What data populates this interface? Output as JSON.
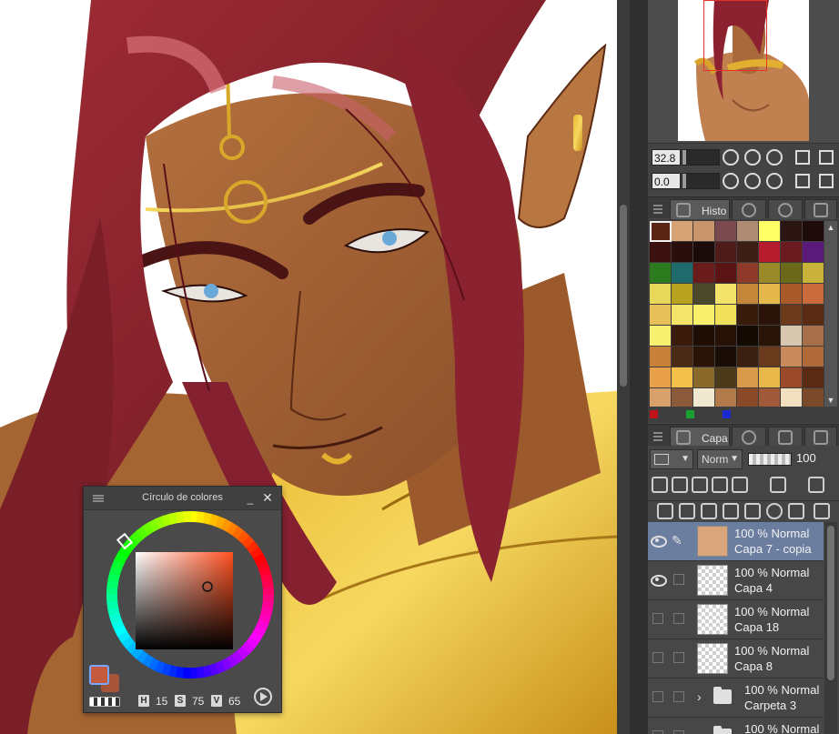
{
  "color_wheel": {
    "title": "Círculo de colores",
    "hsv": {
      "h_label": "H",
      "h_value": "15",
      "s_label": "S",
      "s_value": "75",
      "v_label": "V",
      "v_value": "65"
    }
  },
  "navigator": {
    "zoom": "32.8",
    "rotation": "0.0"
  },
  "palette_panel": {
    "tab_label": "Histo"
  },
  "palette": {
    "colors": [
      "#5a2616",
      "#d8a277",
      "#c9956d",
      "#7a4a50",
      "#b08b73",
      "#ffff66",
      "#2a1513",
      "#1e0c0a",
      "#3b1010",
      "#2a0e0b",
      "#1a0a08",
      "#4f1a1a",
      "#3d1e14",
      "#b71c2e",
      "#6b1a1f",
      "#5a1a7a",
      "#2e7a1f",
      "#1f6a6a",
      "#6a1c1c",
      "#5a1414",
      "#8e3a2a",
      "#9a8a2a",
      "#6a6a1a",
      "#c9b23a",
      "#e8d85a",
      "#b8a21e",
      "#4a4a2a",
      "#f4e36a",
      "#c4873a",
      "#e4b84a",
      "#a85a2a",
      "#c86a3a",
      "#e8c05a",
      "#f4e56a",
      "#f8f06a",
      "#f0e05a",
      "#3a1c0c",
      "#2a140a",
      "#6a3a1a",
      "#5a2a12",
      "#f8f070",
      "#3a1a0a",
      "#1e0e06",
      "#281208",
      "#140a04",
      "#2a1408",
      "#d8c8b0",
      "#a8704a",
      "#c8803a",
      "#4a2a14",
      "#2a1408",
      "#1a0c06",
      "#3a2010",
      "#6a3a1c",
      "#c88a5a",
      "#b06a3a",
      "#e8a04a",
      "#f4c04a",
      "#8a6a2a",
      "#4a3a1a",
      "#d89a4a",
      "#e8b84a",
      "#9a4a2a",
      "#5a2a14",
      "#d8a06a",
      "#8a5a3a",
      "#f0e8d0",
      "#b07a4a",
      "#8a4a2a",
      "#a05a3a",
      "#f0e0c0",
      "#7a4a2a"
    ],
    "footer_colors": [
      "#c0141a",
      "#18a030",
      "#1a2ad0"
    ]
  },
  "layers_panel": {
    "tab_label": "Capa",
    "blend_mode": "Norm",
    "opacity": "100",
    "layers": [
      {
        "mode": "100 % Normal",
        "name": "Capa 7 - copia",
        "selected": true,
        "visible": true,
        "type": "layer",
        "thumb": "art"
      },
      {
        "mode": "100 % Normal",
        "name": "Capa 4",
        "selected": false,
        "visible": true,
        "type": "layer",
        "thumb": "empty"
      },
      {
        "mode": "100 % Normal",
        "name": "Capa 18",
        "selected": false,
        "visible": false,
        "type": "layer",
        "thumb": "empty"
      },
      {
        "mode": "100 % Normal",
        "name": "Capa 8",
        "selected": false,
        "visible": false,
        "type": "layer",
        "thumb": "empty"
      },
      {
        "mode": "100 % Normal",
        "name": "Carpeta 3",
        "selected": false,
        "visible": false,
        "type": "folder"
      },
      {
        "mode": "100 % Normal",
        "name": "",
        "selected": false,
        "visible": false,
        "type": "folder"
      }
    ]
  }
}
